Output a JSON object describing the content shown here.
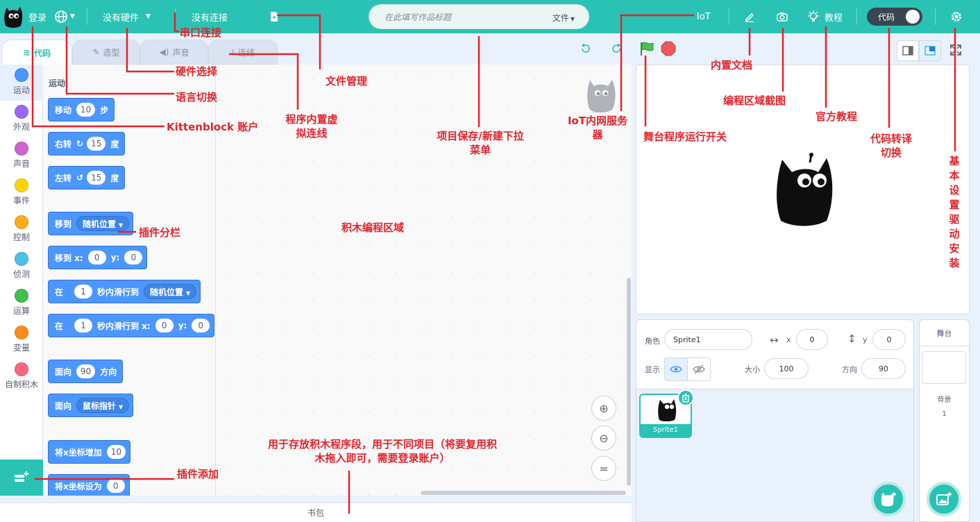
{
  "menubar": {
    "login": "登录",
    "hardware": "没有硬件",
    "connection": "没有连接",
    "title_placeholder": "在此填写作品标题",
    "file_menu": "文件",
    "iot": "IoT",
    "tutorial": "教程",
    "code_toggle": "代码"
  },
  "tabs": {
    "code": "代码",
    "costumes": "造型",
    "sounds": "声音",
    "connect": "连线"
  },
  "categories": [
    {
      "name": "运动",
      "color": "#4c97ff"
    },
    {
      "name": "外观",
      "color": "#9966ff"
    },
    {
      "name": "声音",
      "color": "#cf63cf"
    },
    {
      "name": "事件",
      "color": "#ffd500"
    },
    {
      "name": "控制",
      "color": "#ffab19"
    },
    {
      "name": "侦测",
      "color": "#4cbfe6"
    },
    {
      "name": "运算",
      "color": "#40bf4a"
    },
    {
      "name": "变量",
      "color": "#ff8c1a"
    },
    {
      "name": "自制积木",
      "color": "#ff6680"
    }
  ],
  "palette": {
    "heading": "运动",
    "blocks": {
      "move": {
        "a": "移动",
        "n": "10",
        "b": "步"
      },
      "turn_right": {
        "a": "右转",
        "n": "15",
        "b": "度"
      },
      "turn_left": {
        "a": "左转",
        "n": "15",
        "b": "度"
      },
      "goto": {
        "a": "移到",
        "menu": "随机位置"
      },
      "goto_xy": {
        "a": "移到 x:",
        "x": "0",
        "b": "y:",
        "y": "0"
      },
      "glide": {
        "a": "在",
        "n": "1",
        "b": "秒内滑行到",
        "menu": "随机位置"
      },
      "glide_xy": {
        "a": "在",
        "n": "1",
        "b": "秒内滑行到 x:",
        "x": "0",
        "c": "y:",
        "y": "0"
      },
      "point_dir": {
        "a": "面向",
        "n": "90",
        "b": "方向"
      },
      "point_towards": {
        "a": "面向",
        "menu": "鼠标指针"
      },
      "change_x": {
        "a": "将x坐标增加",
        "n": "10"
      },
      "set_x": {
        "a": "将x坐标设为",
        "n": "0"
      }
    }
  },
  "backpack": "书包",
  "sprite_info": {
    "sprite_label": "角色",
    "sprite_name": "Sprite1",
    "x_label": "x",
    "x_value": "0",
    "y_label": "y",
    "y_value": "0",
    "show_label": "显示",
    "size_label": "大小",
    "size_value": "100",
    "direction_label": "方向",
    "direction_value": "90"
  },
  "sprite_list": [
    {
      "name": "Sprite1"
    }
  ],
  "stage_target": {
    "title": "舞台",
    "backdrop_label": "背景",
    "backdrop_count": "1"
  },
  "annotations": {
    "serial": "串口连接",
    "hardware_select": "硬件选择",
    "language": "语言切换",
    "account": "Kittenblock 账户",
    "virtual_wire": "程序内置虚拟连线",
    "file_manage": "文件管理",
    "project_menu": "项目保存/新建下拉菜单",
    "iot_server": "IoT内网服务器",
    "docs": "内置文档",
    "screenshot": "编程区域截图",
    "tutorial": "官方教程",
    "stage_run": "舞台程序运行开关",
    "code_translate": "代码转译切换",
    "settings": "基本设置驱动安装",
    "ext_column": "插件分栏",
    "workspace": "积木编程区域",
    "backpack_desc": "用于存放积木程序段，用于不同项目（将要复用积木拖入即可，需要登录账户）",
    "ext_add": "插件添加"
  },
  "colors": {
    "brand": "#2ac2b4",
    "motion": "#4c97ff",
    "annotation": "#e3232c"
  }
}
